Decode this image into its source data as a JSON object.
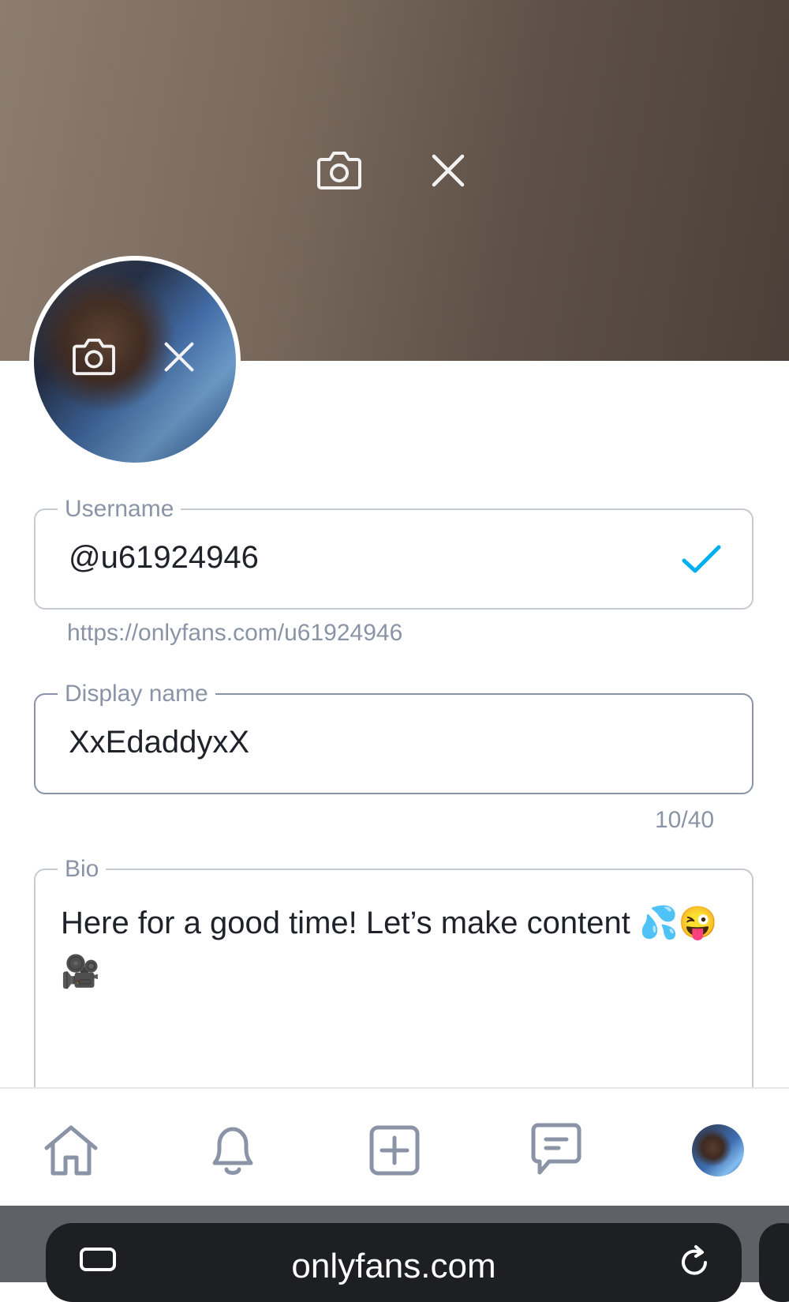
{
  "username": {
    "label": "Username",
    "value": "@u61924946",
    "url_hint": "https://onlyfans.com/u61924946"
  },
  "display_name": {
    "label": "Display name",
    "value": "XxEdaddyxX",
    "counter": "10/40"
  },
  "bio": {
    "label": "Bio",
    "value": "Here for a good time! Let’s make content 💦😜🎥"
  },
  "icons": {
    "cover_upload": "camera-icon",
    "cover_remove": "close-icon",
    "avatar_upload": "camera-icon",
    "avatar_remove": "close-icon",
    "username_valid": "check-icon",
    "nav": [
      "home-icon",
      "bell-icon",
      "plus-square-icon",
      "message-icon",
      "avatar"
    ]
  },
  "browser": {
    "url": "onlyfans.com"
  },
  "colors": {
    "accent": "#00aff0",
    "border": "#c5cad3",
    "muted_text": "#8a94a6"
  }
}
